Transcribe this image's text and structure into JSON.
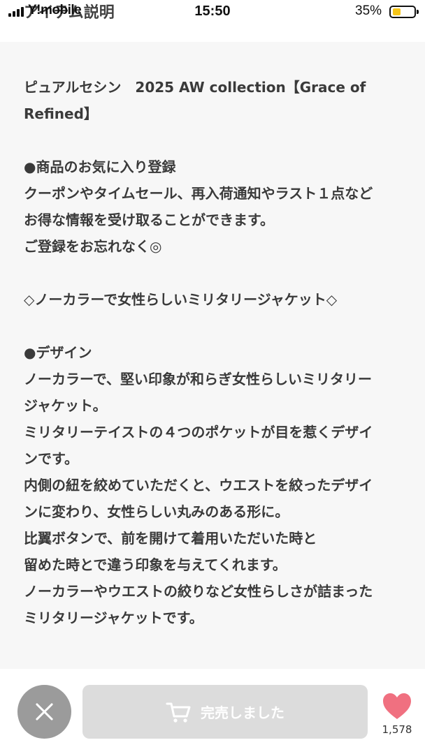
{
  "status_bar": {
    "carrier": "Y!mobile",
    "page_title": "アイテム説明",
    "time": "15:50",
    "battery_percent": "35%",
    "battery_level": 0.35,
    "battery_color": "#f5c518"
  },
  "description": {
    "lines": [
      "ピュアルセシン　2025 AW collection【Grace of",
      "Refined】",
      "",
      "●商品のお気に入り登録",
      "クーポンやタイムセール、再入荷通知やラスト１点など",
      "お得な情報を受け取ることができます。",
      "ご登録をお忘れなく◎",
      "",
      "◇ノーカラーで女性らしいミリタリージャケット◇",
      "",
      "●デザイン",
      "ノーカラーで、堅い印象が和らぎ女性らしいミリタリー",
      "ジャケット。",
      "ミリタリーテイストの４つのポケットが目を惹くデザイ",
      "ンです。",
      "内側の紐を絞めていただくと、ウエストを絞ったデザイ",
      "ンに変わり、女性らしい丸みのある形に。",
      "比翼ボタンで、前を開けて着用いただいた時と",
      "留めた時とで違う印象を与えてくれます。",
      "ノーカラーやウエストの絞りなど女性らしさが詰まった",
      "ミリタリージャケットです。"
    ]
  },
  "bottom_bar": {
    "close_icon": "close-icon",
    "cart_icon": "cart-icon",
    "soldout_label": "完売しました",
    "heart_icon": "heart-icon",
    "favorite_count": "1,578",
    "heart_color": "#f07080",
    "button_color": "#dcdcdc"
  }
}
